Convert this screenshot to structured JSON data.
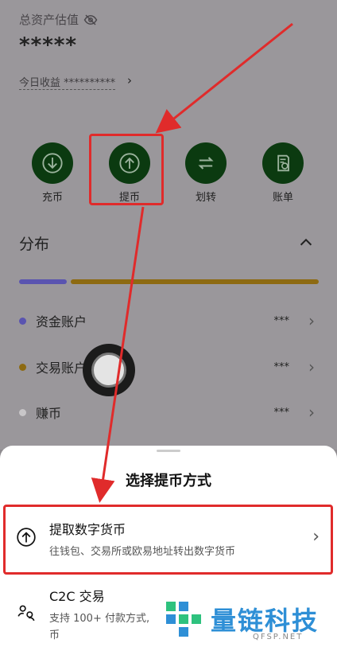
{
  "header": {
    "asset_label": "总资产估值",
    "asset_value": "*****",
    "today_label": "今日收益 **********",
    "today_arrow": "›"
  },
  "actions": [
    {
      "label": "充币",
      "icon": "download-icon"
    },
    {
      "label": "提币",
      "icon": "upload-icon"
    },
    {
      "label": "划转",
      "icon": "transfer-icon"
    },
    {
      "label": "账单",
      "icon": "bill-icon"
    }
  ],
  "distribution": {
    "title": "分布",
    "rows": [
      {
        "label": "资金账户",
        "value": "***",
        "color": "#5a54b0"
      },
      {
        "label": "交易账户",
        "value": "***",
        "color": "#8d6a12"
      },
      {
        "label": "赚币",
        "value": "***",
        "color": "#9c9a9c"
      }
    ],
    "bar_colors": [
      "#5a54b0",
      "#8d6a12"
    ]
  },
  "sheet": {
    "title": "选择提币方式",
    "options": [
      {
        "title": "提取数字货币",
        "desc": "往钱包、交易所或欧易地址转出数字货币",
        "icon": "upload-icon"
      },
      {
        "title": "C2C 交易",
        "desc": "支持 100+ 付款方式,",
        "desc2": "币",
        "icon": "people-exchange-icon"
      }
    ]
  },
  "watermark": {
    "text": "量链科技",
    "sub": "QFSP.NET"
  },
  "colors": {
    "accent_red": "#e02b2b",
    "action_green": "#0b3a10"
  }
}
